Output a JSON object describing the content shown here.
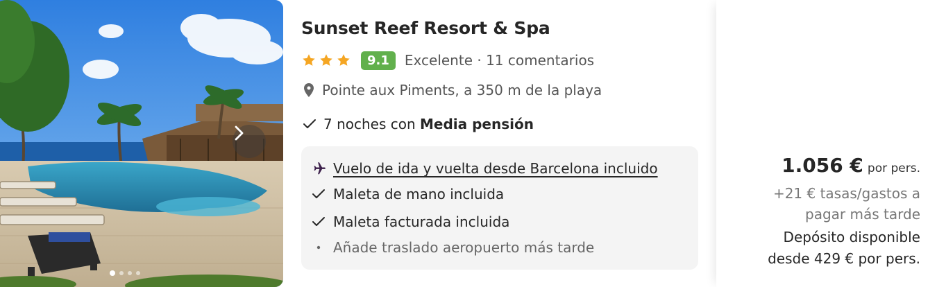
{
  "hotel": {
    "name": "Sunset Reef Resort & Spa",
    "stars": 3,
    "score": "9.1",
    "rating_text": "Excelente · 11 comentarios",
    "location": "Pointe aux Piments, a 350 m de la playa",
    "board_prefix": "7 noches con",
    "board_name": "Media pensión"
  },
  "features": [
    {
      "icon": "plane-icon",
      "text": "Vuelo de ida y vuelta desde Barcelona incluido",
      "link": true
    },
    {
      "icon": "check-icon",
      "text": "Maleta de mano incluida"
    },
    {
      "icon": "check-icon",
      "text": "Maleta facturada incluida"
    },
    {
      "icon": "bullet-icon",
      "text": "Añade traslado aeropuerto más tarde"
    }
  ],
  "gallery": {
    "image_count": 4,
    "active_index": 0
  },
  "pricing": {
    "price": "1.056 €",
    "per_label": "por pers.",
    "fees": "+21 € tasas/gastos a pagar más tarde",
    "deposit": "Depósito disponible desde 429 € por pers."
  },
  "colors": {
    "score_badge": "#61b04c",
    "star": "#f5a623",
    "plane": "#3b1f4a"
  }
}
